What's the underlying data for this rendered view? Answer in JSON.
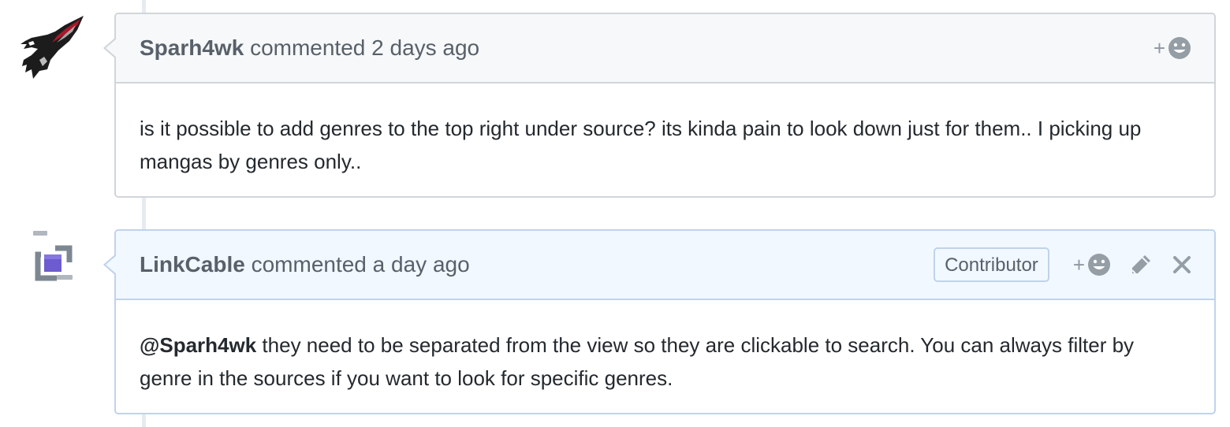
{
  "comments": [
    {
      "author": "Sparh4wk",
      "action": "commented",
      "time": "2 days ago",
      "body": "is it possible to add genres to the top right under source? its kinda pain to look down just for them.. I picking up mangas by genres only..",
      "avatar_icon": "eagle-avatar-icon",
      "reaction_icon": "smiley-icon"
    },
    {
      "author": "LinkCable",
      "action": "commented",
      "time": "a day ago",
      "badge": "Contributor",
      "mention": "@Sparh4wk",
      "body": "they need to be separated from the view so they are clickable to search. You can always filter by genre in the sources if you want to look for specific genres.",
      "avatar_icon": "link-cable-avatar-icon",
      "reaction_icon": "smiley-icon",
      "edit_icon": "pencil-icon",
      "delete_icon": "close-icon"
    }
  ],
  "colors": {
    "timeline": "#e6ebf1",
    "header_bg_1": "#f6f8fa",
    "header_bg_2": "#f1f8ff",
    "border_1": "#d1d5da",
    "border_2": "#c0d3eb",
    "muted_text": "#586069"
  }
}
